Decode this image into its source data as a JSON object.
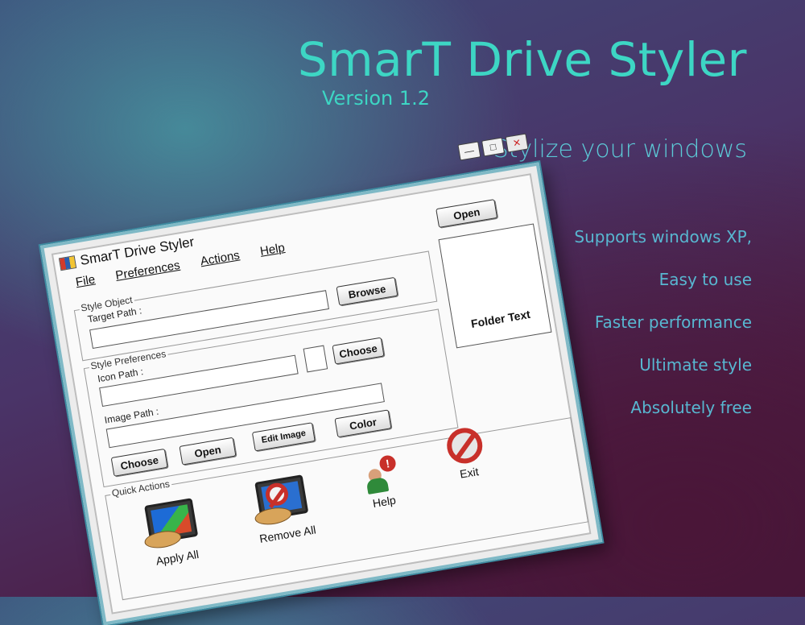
{
  "promo": {
    "title": "SmarT Drive Styler",
    "version": "Version 1.2",
    "tagline": "Stylize your windows",
    "features": [
      "Supports windows XP,",
      "Easy to use",
      "Faster performance",
      "Ultimate style",
      "Absolutely free"
    ]
  },
  "window": {
    "title": "SmarT Drive Styler",
    "menu": [
      "File",
      "Preferences",
      "Actions",
      "Help"
    ],
    "controls": {
      "minimize": "—",
      "maximize": "□",
      "close": "✕"
    }
  },
  "style_object": {
    "group_label": "Style Object",
    "target_path_label": "Target Path :",
    "target_path_value": "",
    "browse_label": "Browse",
    "open_label": "Open"
  },
  "style_preferences": {
    "group_label": "Style Preferences",
    "icon_path_label": "Icon Path :",
    "icon_path_value": "",
    "choose_icon_label": "Choose",
    "image_path_label": "Image Path :",
    "image_path_value": "",
    "color_label": "Color",
    "edit_image_label": "Edit Image",
    "open_label": "Open",
    "choose_image_label": "Choose"
  },
  "preview": {
    "folder_text": "Folder Text"
  },
  "quick_actions": {
    "group_label": "Quick Actions",
    "apply_all": "Apply All",
    "remove_all": "Remove All",
    "help": "Help",
    "exit": "Exit"
  },
  "colors": {
    "accent": "#3dd6c4",
    "feature_text": "#58b7d1",
    "window_border": "#7fb9c6"
  }
}
